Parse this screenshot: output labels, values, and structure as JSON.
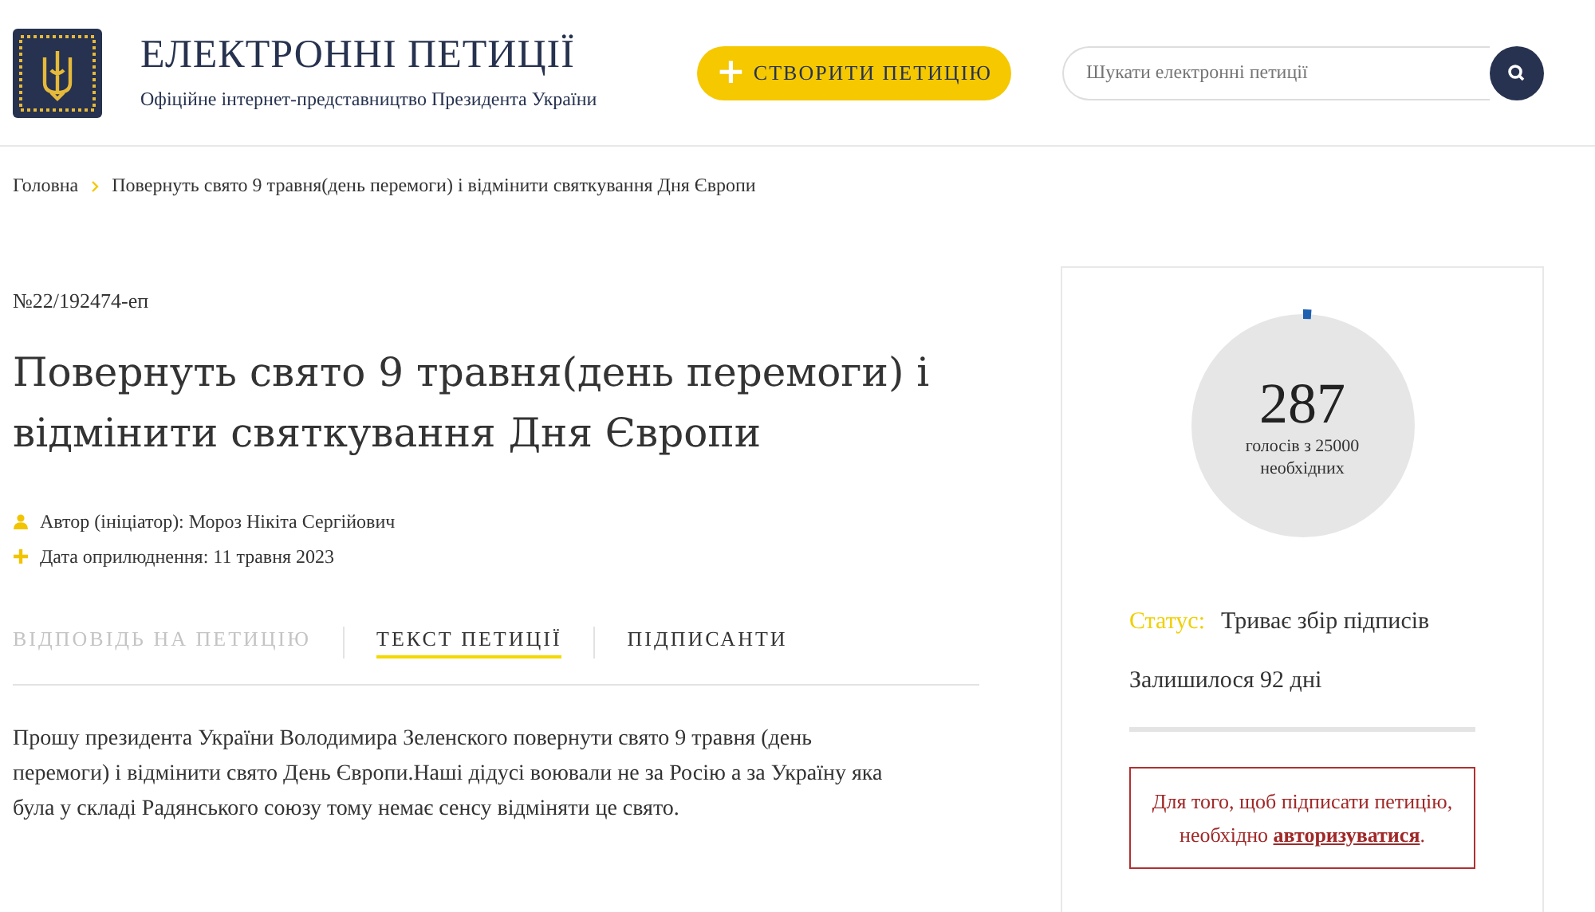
{
  "header": {
    "title": "ЕЛЕКТРОННІ ПЕТИЦІЇ",
    "subtitle": "Офіційне інтернет-представництво Президента України",
    "create_button": {
      "icon": "+",
      "label": "СТВОРИТИ ПЕТИЦІЮ"
    },
    "search": {
      "placeholder": "Шукати електронні петиції"
    }
  },
  "breadcrumbs": [
    {
      "label": "Головна"
    },
    {
      "label": "Повернуть свято 9 травня(день перемоги) і відмінити святкування Дня Європи"
    }
  ],
  "petition": {
    "number": "№22/192474-еп",
    "title": "Повернуть свято 9 травня(день перемоги) і відмінити святкування Дня Європи",
    "meta": [
      {
        "kind": "author",
        "text": "Автор (ініціатор): Мороз Нікіта Сергійович"
      },
      {
        "kind": "date",
        "text": "Дата оприлюднення: 11 травня 2023"
      }
    ],
    "tabs": [
      {
        "label": "ВІДПОВІДЬ НА ПЕТИЦІЮ",
        "selected": false,
        "disabled": true
      },
      {
        "label": "ТЕКСТ ПЕТИЦІЇ",
        "selected": true,
        "disabled": false
      },
      {
        "label": "ПІДПИСАНТИ",
        "selected": false,
        "disabled": false
      }
    ],
    "text": "Прошу президента України Володимира Зеленского повернути свято 9 травня (день перемоги) і відмінити свято День Європи.Наші дідусі воювали не за Росію а за Україну яка була у складі Радянського союзу тому немає сенсу відміняти це свято."
  },
  "sidebar": {
    "votes": "287",
    "votes_caption": "голосів з 25000 необхідних",
    "level": 0.0115,
    "status_label": "Статус:",
    "status": "Триває збір підписів",
    "remaining": "Залишилося 92 дні",
    "auth_notice": "Для того, щоб підписати петицію, необхідно",
    "auth_link": "авторизуватися",
    "auth_end": "."
  }
}
